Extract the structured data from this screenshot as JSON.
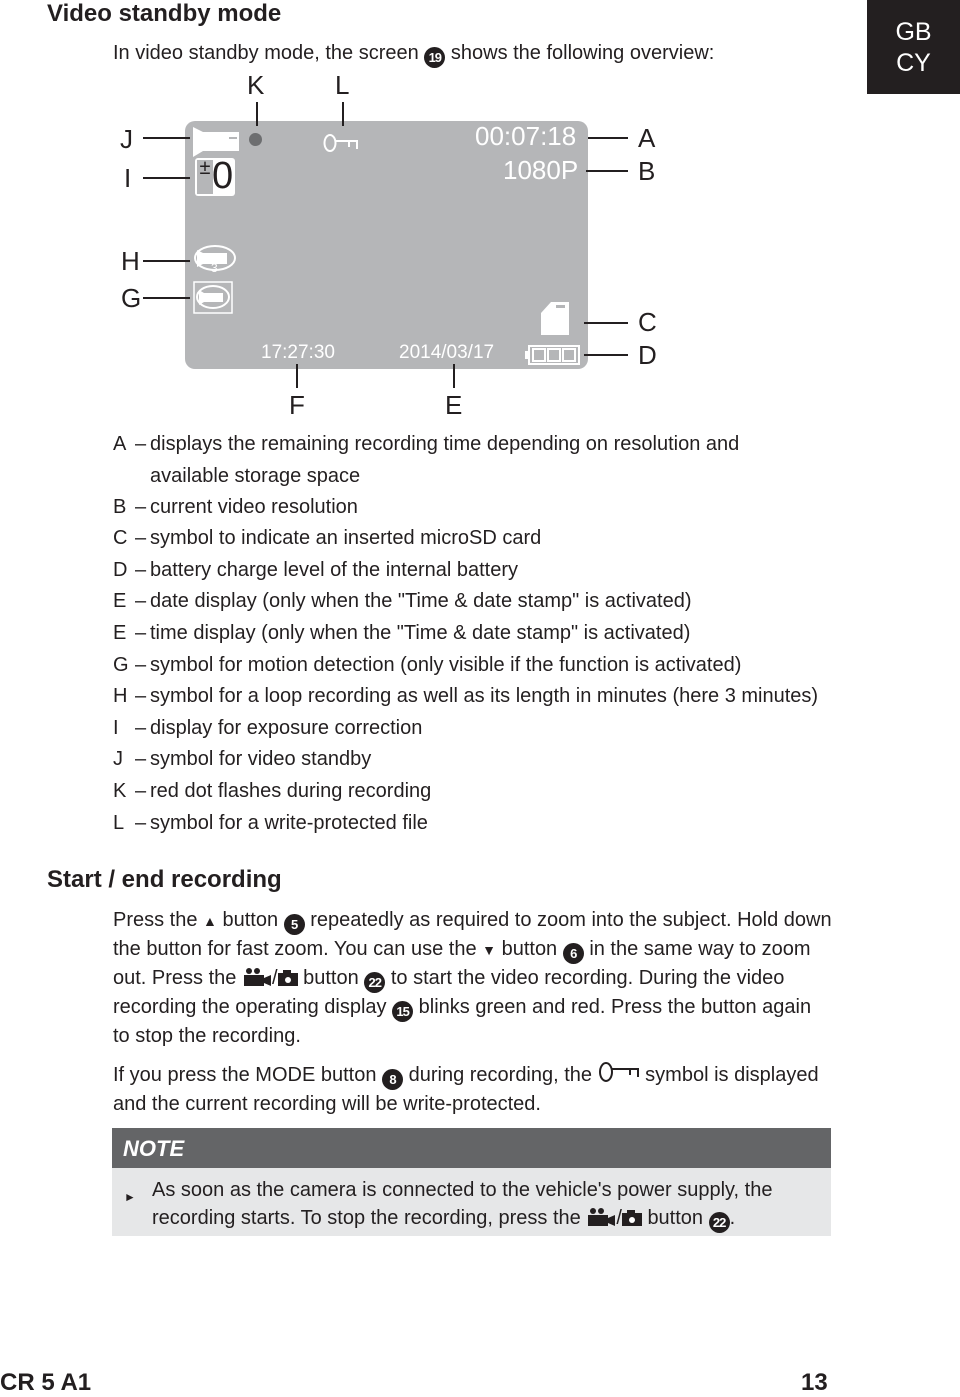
{
  "section_title": "Video standby mode",
  "language_tab": {
    "line1": "GB",
    "line2": "CY"
  },
  "intro": {
    "before": "In video standby mode, the screen",
    "ref": "19",
    "after": "shows the following overview:"
  },
  "diagram": {
    "labels": {
      "A": "A",
      "B": "B",
      "C": "C",
      "D": "D",
      "E": "E",
      "F": "F",
      "G": "G",
      "H": "H",
      "I": "I",
      "J": "J",
      "K": "K",
      "L": "L"
    },
    "remaining_time": "00:07:18",
    "resolution": "1080P",
    "exposure": "0",
    "loop_minutes": "3",
    "time": "17:27:30",
    "date": "2014/03/17",
    "screen_color": "#b5b6b8",
    "battery_level": 1.0
  },
  "legend": [
    {
      "key": "A",
      "text": "displays the remaining recording time depending on resolution and",
      "cont": "available storage space"
    },
    {
      "key": "B",
      "text": "current video resolution"
    },
    {
      "key": "C",
      "text": "symbol to indicate an inserted microSD card"
    },
    {
      "key": "D",
      "text": "battery charge level of the internal battery"
    },
    {
      "key": "E",
      "text": "date display (only when the \"Time & date stamp\" is activated)"
    },
    {
      "key": "E",
      "text": "time display (only when the \"Time & date stamp\" is activated)"
    },
    {
      "key": "G",
      "text": "symbol for motion detection (only visible if the function is activated)"
    },
    {
      "key": "H",
      "text": "symbol for a loop recording as well as its length in minutes (here 3 minutes)"
    },
    {
      "key": "I",
      "text": "display for exposure correction"
    },
    {
      "key": "J",
      "text": "symbol for video standby"
    },
    {
      "key": "K",
      "text": "red dot flashes during recording"
    },
    {
      "key": "L",
      "text": "symbol for a write-protected file"
    }
  ],
  "dash": "–",
  "section2_title": "Start / end recording",
  "para1": {
    "s1": "Press the",
    "up": "▲",
    "s2": "button",
    "r1": "5",
    "s3": "repeatedly as required to zoom into the subject. Hold down the button for fast zoom. You can use the",
    "down": "▼",
    "s4": "button",
    "r2": "6",
    "s5": "in the same way to zoom out. Press the",
    "slash": "/",
    "s6": "button",
    "r3": "22",
    "s7": "to start the video recording. During the video recording the operating display",
    "r4": "15",
    "s8": "blinks green and red. Press the button again to stop the recording."
  },
  "para2": {
    "s1": "If you press the MODE button",
    "r1": "8",
    "s2": "during recording, the",
    "s3": "symbol is displayed and the current recording will be write-protected."
  },
  "note": {
    "title": "NOTE",
    "s1": "As soon as the camera is connected to the vehicle's power supply, the recording starts. To stop the recording, press the",
    "slash": "/",
    "s2": "button",
    "r1": "22",
    "end": "."
  },
  "footer": {
    "model": "CR 5 A1",
    "page": "13"
  }
}
